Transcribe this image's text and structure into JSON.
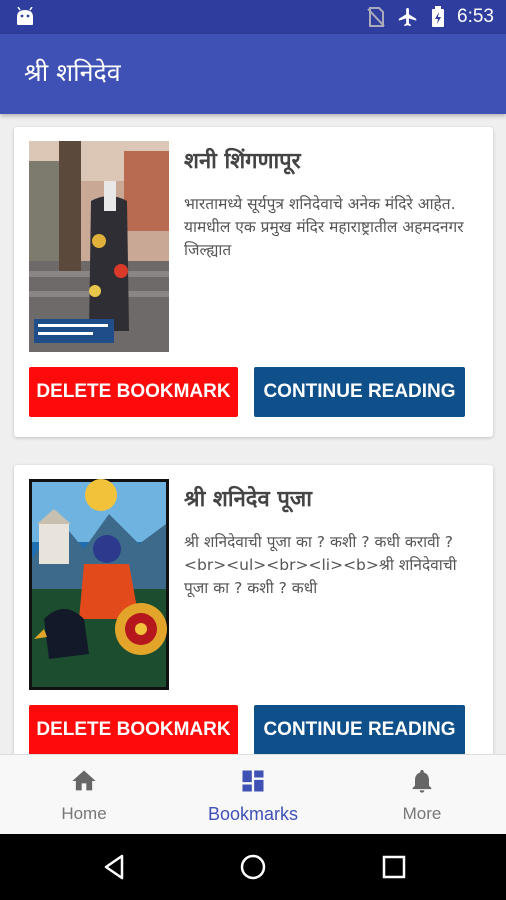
{
  "status_bar": {
    "time": "6:53"
  },
  "app_bar": {
    "title": "श्री शनिदेव"
  },
  "cards": [
    {
      "title": "शनी शिंगणापूर",
      "description": "भारतामध्ये सूर्यपुत्र शनिदेवाचे अनेक मंदिरे आहेत. यामधील एक प्रमुख मंदिर महाराष्ट्रातील अहमदनगर जिल्ह्यात",
      "delete_label": "DELETE BOOKMARK",
      "continue_label": "CONTINUE READING"
    },
    {
      "title": "श्री शनिदेव पूजा",
      "description": "श्री शनिदेवाची पूजा का ? कशी ? कधी करावी ?<br><ul><br><li><b>श्री शनिदेवाची पूजा का ? कशी ? कधी",
      "delete_label": "DELETE BOOKMARK",
      "continue_label": "CONTINUE READING"
    }
  ],
  "bottom_nav": {
    "items": [
      {
        "label": "Home",
        "icon": "home-icon",
        "active": false
      },
      {
        "label": "Bookmarks",
        "icon": "dashboard-icon",
        "active": true
      },
      {
        "label": "More",
        "icon": "bell-icon",
        "active": false
      }
    ]
  },
  "colors": {
    "status_bar": "#2f3e9e",
    "app_bar": "#3f51b5",
    "delete_button": "#fd0a0a",
    "continue_button": "#10508a",
    "active_nav": "#3f51b5"
  }
}
